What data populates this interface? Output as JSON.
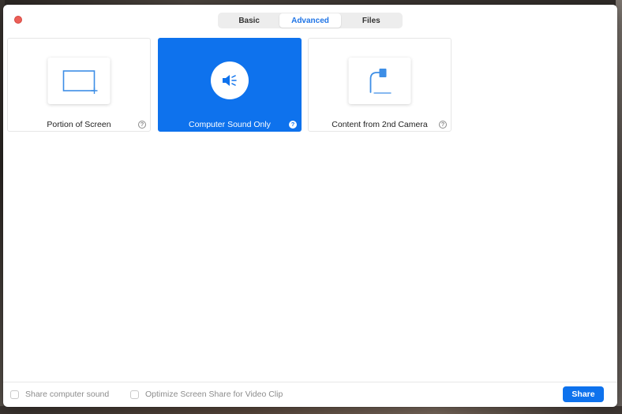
{
  "tabs": [
    {
      "label": "Basic",
      "active": false
    },
    {
      "label": "Advanced",
      "active": true
    },
    {
      "label": "Files",
      "active": false
    }
  ],
  "options": [
    {
      "label": "Portion of Screen",
      "icon": "portion-of-screen-icon",
      "selected": false
    },
    {
      "label": "Computer Sound Only",
      "icon": "speaker-icon",
      "selected": true
    },
    {
      "label": "Content from 2nd Camera",
      "icon": "document-camera-icon",
      "selected": false
    }
  ],
  "help_glyph": "?",
  "footer": {
    "share_sound_label": "Share computer sound",
    "optimize_label": "Optimize Screen Share for Video Clip",
    "share_button": "Share"
  },
  "colors": {
    "accent": "#0e72ed",
    "close": "#ec5f58",
    "icon_blue": "#3d8ee6"
  }
}
